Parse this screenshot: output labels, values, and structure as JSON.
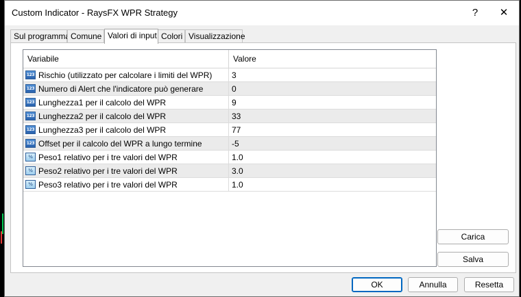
{
  "window": {
    "title": "Custom Indicator - RaysFX WPR Strategy",
    "help_label": "?",
    "close_label": "✕"
  },
  "tabs": [
    {
      "label": "Sul programma",
      "active": false
    },
    {
      "label": "Comune",
      "active": false
    },
    {
      "label": "Valori di input",
      "active": true
    },
    {
      "label": "Colori",
      "active": false
    },
    {
      "label": "Visualizzazione",
      "active": false
    }
  ],
  "grid": {
    "headers": {
      "variable": "Variabile",
      "value": "Valore"
    },
    "rows": [
      {
        "icon": "integer-icon",
        "icon_text": "123",
        "variable": "Rischio (utilizzato per calcolare i limiti del WPR)",
        "value": "3"
      },
      {
        "icon": "integer-icon",
        "icon_text": "123",
        "variable": "Numero di Alert che l'indicatore può generare",
        "value": "0"
      },
      {
        "icon": "integer-icon",
        "icon_text": "123",
        "variable": "Lunghezza1 per il calcolo del WPR",
        "value": "9"
      },
      {
        "icon": "integer-icon",
        "icon_text": "123",
        "variable": "Lunghezza2 per il calcolo del WPR",
        "value": "33"
      },
      {
        "icon": "integer-icon",
        "icon_text": "123",
        "variable": "Lunghezza3 per il calcolo del WPR",
        "value": "77"
      },
      {
        "icon": "integer-icon",
        "icon_text": "123",
        "variable": "Offset per il calcolo del WPR a lungo termine",
        "value": "-5"
      },
      {
        "icon": "double-icon",
        "icon_text": "½",
        "variable": "Peso1 relativo per i tre valori del WPR",
        "value": "1.0"
      },
      {
        "icon": "double-icon",
        "icon_text": "½",
        "variable": "Peso2 relativo per i tre valori del WPR",
        "value": "3.0"
      },
      {
        "icon": "double-icon",
        "icon_text": "½",
        "variable": "Peso3 relativo per i tre valori del WPR",
        "value": "1.0"
      }
    ]
  },
  "side_buttons": {
    "load_label": "Carica",
    "save_label": "Salva"
  },
  "footer_buttons": {
    "ok_label": "OK",
    "cancel_label": "Annulla",
    "reset_label": "Resetta"
  },
  "colors": {
    "chart_up": "#00c853",
    "chart_down": "#e53935",
    "accent": "#0067c0"
  }
}
